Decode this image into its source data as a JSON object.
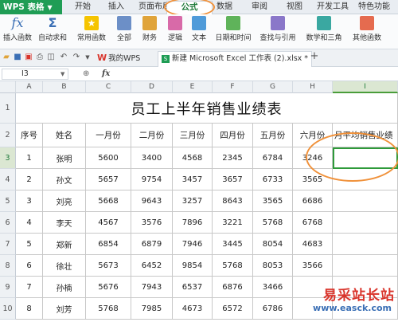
{
  "menubar": {
    "app_label": "WPS 表格",
    "items": [
      "开始",
      "插入",
      "页面布局",
      "公式",
      "数据",
      "审阅",
      "视图",
      "开发工具",
      "特色功能"
    ]
  },
  "ribbon": {
    "buttons": [
      {
        "label": "插入函数",
        "icon": "fx-icon"
      },
      {
        "label": "自动求和",
        "icon": "sum-icon"
      },
      {
        "label": "常用函数",
        "icon": "star-icon"
      },
      {
        "label": "全部",
        "icon": "all-functions-icon"
      },
      {
        "label": "财务",
        "icon": "finance-icon"
      },
      {
        "label": "逻辑",
        "icon": "logic-icon"
      },
      {
        "label": "文本",
        "icon": "text-icon"
      },
      {
        "label": "日期和时间",
        "icon": "datetime-icon"
      },
      {
        "label": "查找与引用",
        "icon": "lookup-icon"
      },
      {
        "label": "数学和三角",
        "icon": "math-icon"
      },
      {
        "label": "其他函数",
        "icon": "other-functions-icon"
      }
    ]
  },
  "tabs": {
    "wps_tab": "我的WPS",
    "file_tab": "新建 Microsoft Excel 工作表 (2).xlsx *",
    "add_label": "+"
  },
  "formula_bar": {
    "cell_ref": "I3",
    "fx_label": "fx",
    "content": ""
  },
  "sheet": {
    "columns": [
      "A",
      "B",
      "C",
      "D",
      "E",
      "F",
      "G",
      "H",
      "I"
    ],
    "row_numbers": [
      "1",
      "2",
      "3",
      "4",
      "5",
      "6",
      "7",
      "8",
      "9",
      "10"
    ],
    "title": "员工上半年销售业绩表",
    "headers": [
      "序号",
      "姓名",
      "一月份",
      "二月份",
      "三月份",
      "四月份",
      "五月份",
      "六月份",
      "月平均销售业绩"
    ],
    "rows": [
      [
        "1",
        "张明",
        "5600",
        "3400",
        "4568",
        "2345",
        "6784",
        "3246",
        ""
      ],
      [
        "2",
        "孙文",
        "5657",
        "9754",
        "3457",
        "3657",
        "6733",
        "3565",
        ""
      ],
      [
        "3",
        "刘亮",
        "5668",
        "9643",
        "3257",
        "8643",
        "3565",
        "6686",
        ""
      ],
      [
        "4",
        "李天",
        "4567",
        "3576",
        "7896",
        "3221",
        "5768",
        "6768",
        ""
      ],
      [
        "5",
        "郑新",
        "6854",
        "6879",
        "7946",
        "3445",
        "8054",
        "4683",
        ""
      ],
      [
        "6",
        "徐壮",
        "5673",
        "6452",
        "9854",
        "5768",
        "8053",
        "3566",
        ""
      ],
      [
        "7",
        "孙楠",
        "5676",
        "7943",
        "6537",
        "6876",
        "3466",
        "",
        ""
      ],
      [
        "8",
        "刘芳",
        "5768",
        "7985",
        "4673",
        "6572",
        "6786",
        "",
        ""
      ]
    ]
  },
  "watermark": {
    "text": "易采站长站",
    "url": "www.easck.com"
  }
}
